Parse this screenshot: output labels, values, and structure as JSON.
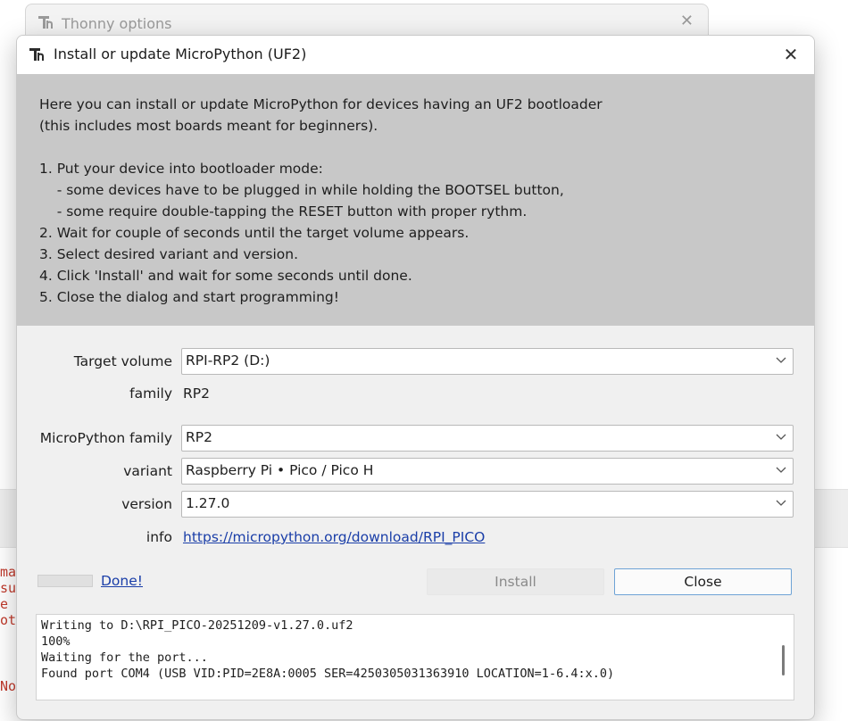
{
  "background": {
    "window_title": "Thonny options",
    "code_lines": [
      "ma",
      "su",
      "e",
      "ot",
      "No"
    ]
  },
  "dialog": {
    "title": "Install or update MicroPython (UF2)",
    "intro": [
      "Here you can install or update MicroPython for devices having an UF2 bootloader",
      "(this includes most boards meant for beginners).",
      "",
      "1. Put your device into bootloader mode:",
      "    - some devices have to be plugged in while holding the BOOTSEL button,",
      "    - some require double-tapping the RESET button with proper rythm.",
      "2. Wait for couple of seconds until the target volume appears.",
      "3. Select desired variant and version.",
      "4. Click 'Install' and wait for some seconds until done.",
      "5. Close the dialog and start programming!"
    ],
    "form": {
      "target_volume_label": "Target volume",
      "target_volume_value": "RPI-RP2 (D:)",
      "family_label": "family",
      "family_value": "RP2",
      "mp_family_label": "MicroPython family",
      "mp_family_value": "RP2",
      "variant_label": "variant",
      "variant_value": "Raspberry Pi • Pico / Pico H",
      "version_label": "version",
      "version_value": "1.27.0",
      "info_label": "info",
      "info_link": "https://micropython.org/download/RPI_PICO"
    },
    "status": {
      "done_text": "Done!"
    },
    "buttons": {
      "install_label": "Install",
      "close_label": "Close"
    },
    "log": [
      "Writing to D:\\RPI_PICO-20251209-v1.27.0.uf2",
      "100%",
      "Waiting for the port...",
      "Found port COM4 (USB VID:PID=2E8A:0005 SER=4250305031363910 LOCATION=1-6.4:x.0)"
    ]
  }
}
